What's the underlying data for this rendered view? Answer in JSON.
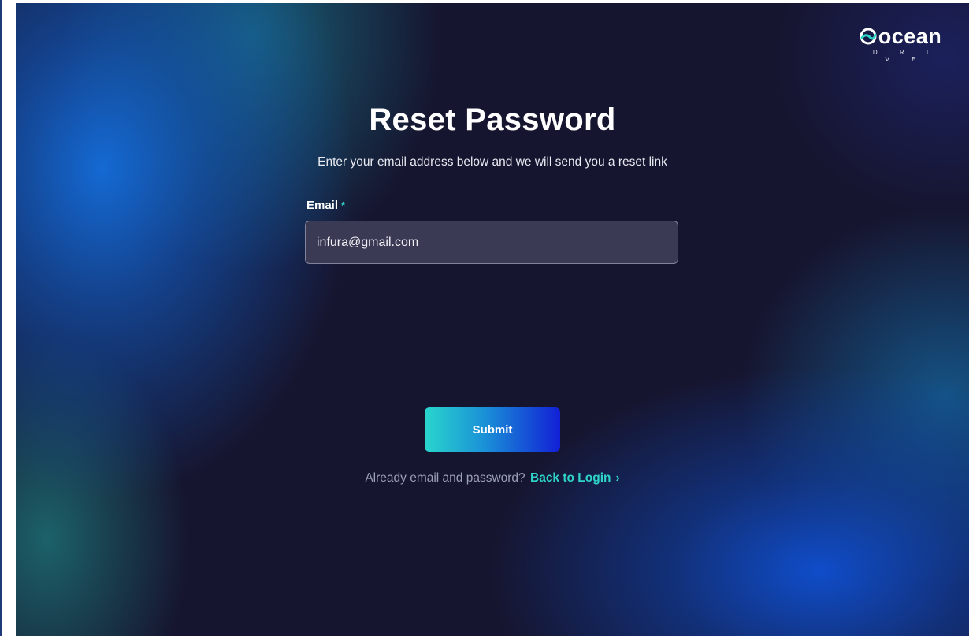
{
  "brand": {
    "name": "ocean",
    "sub": "D R I V E",
    "accent": "#2fd4c9"
  },
  "page": {
    "title": "Reset Password",
    "subtitle": "Enter your email address below and we will send you a reset link"
  },
  "form": {
    "email_label": "Email",
    "required_mark": "*",
    "email_value": "infura@gmail.com",
    "submit_label": "Submit"
  },
  "footer": {
    "prompt": "Already email and password?",
    "link_label": "Back to Login",
    "link_icon": "chevron-right-icon"
  },
  "colors": {
    "background": "#16152f",
    "input_bg": "#3b3a55",
    "button_gradient_start": "#29d6cd",
    "button_gradient_end": "#1220d6"
  }
}
